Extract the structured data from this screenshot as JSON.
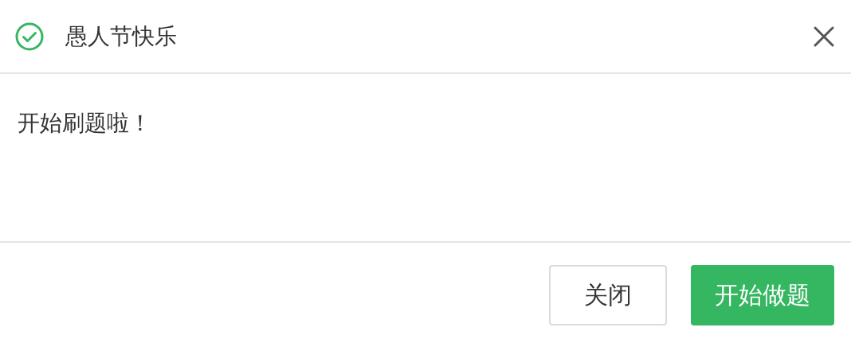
{
  "dialog": {
    "title": "愚人节快乐",
    "message": "开始刷题啦！",
    "buttons": [
      {
        "label": "关闭",
        "kind": "secondary"
      },
      {
        "label": "开始做题",
        "kind": "primary"
      }
    ]
  }
}
